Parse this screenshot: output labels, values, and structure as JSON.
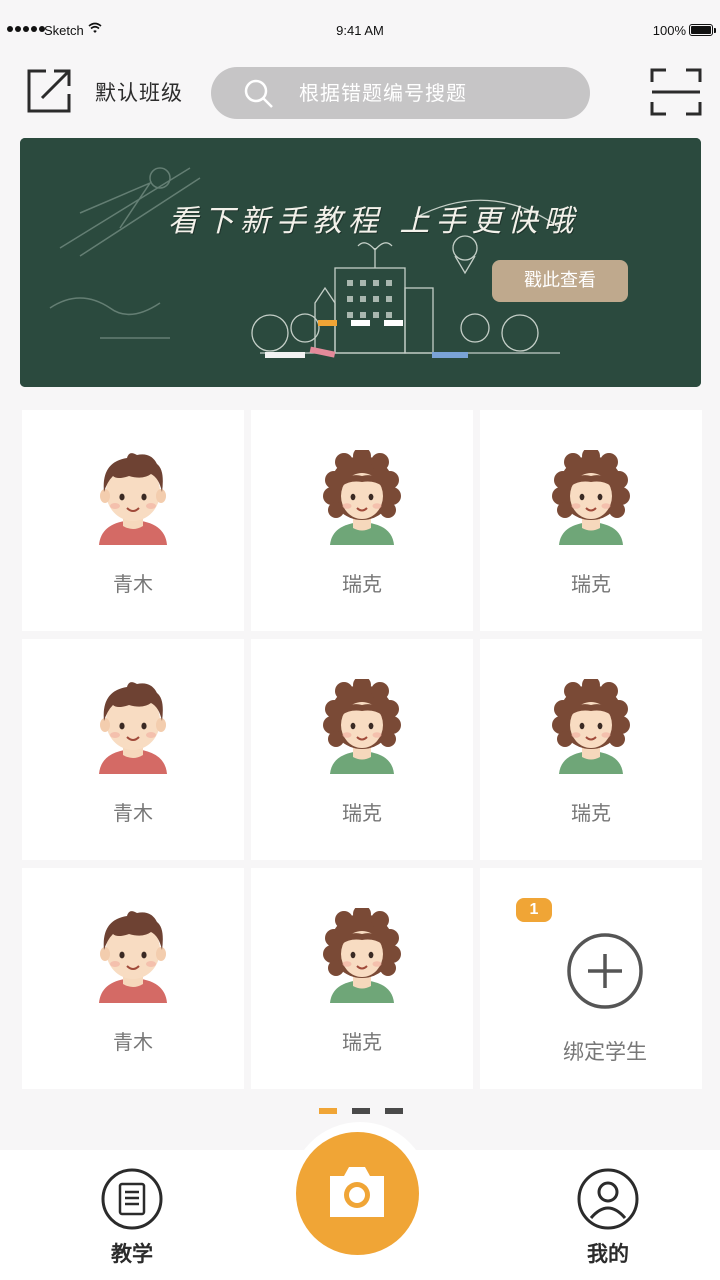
{
  "status_bar": {
    "carrier": "Sketch",
    "time": "9:41 AM",
    "battery": "100%"
  },
  "header": {
    "title": "默认班级",
    "search_placeholder": "根据错题编号搜题"
  },
  "banner": {
    "title": "看下新手教程 上手更快哦",
    "cta": "戳此查看",
    "slides": 3,
    "active_slide": 0
  },
  "students": [
    {
      "name": "青木",
      "avatar": "boy-avatar"
    },
    {
      "name": "瑞克",
      "avatar": "girl-avatar"
    },
    {
      "name": "瑞克",
      "avatar": "girl-avatar"
    },
    {
      "name": "青木",
      "avatar": "boy-avatar"
    },
    {
      "name": "瑞克",
      "avatar": "girl-avatar"
    },
    {
      "name": "瑞克",
      "avatar": "girl-avatar"
    },
    {
      "name": "青木",
      "avatar": "boy-avatar"
    },
    {
      "name": "瑞克",
      "avatar": "girl-avatar"
    }
  ],
  "bind_card": {
    "label": "绑定学生",
    "badge": "1"
  },
  "pager": {
    "pages": 3,
    "active_page": 0
  },
  "tab_bar": {
    "teaching_label": "教学",
    "mine_label": "我的"
  },
  "colors": {
    "accent": "#f0a536",
    "banner_bg": "#2b4a3e",
    "cta_bg": "#bfa98d",
    "search_bg": "#c6c5c6"
  }
}
